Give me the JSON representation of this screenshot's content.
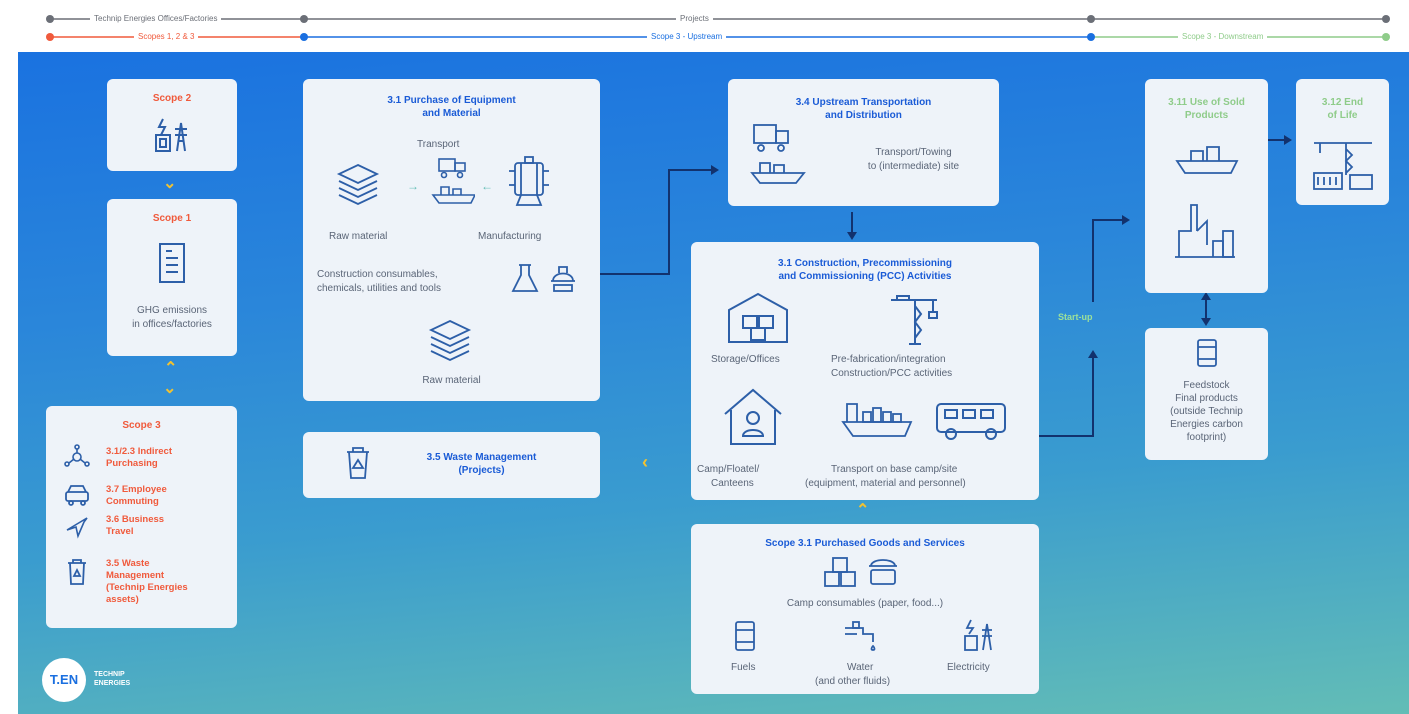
{
  "timeline": {
    "row1": {
      "label_a": "Technip Energies Offices/Factories",
      "label_b": "Projects",
      "color": "#6b6f77"
    },
    "row2": {
      "label_a": "Scopes 1, 2 & 3",
      "label_b": "Scope 3 - Upstream",
      "label_c": "Scope 3 - Downstream",
      "colors": {
        "a": "#f05a3c",
        "b": "#1a6fe0",
        "c": "#8fcc8a"
      }
    }
  },
  "scope2": {
    "title": "Scope 2"
  },
  "scope1": {
    "title": "Scope 1",
    "text1": "GHG emissions",
    "text2": "in offices/factories"
  },
  "scope3": {
    "title": "Scope 3",
    "item1": [
      "3.1/2.3 Indirect",
      "Purchasing"
    ],
    "item2": [
      "3.7 Employee",
      "Commuting"
    ],
    "item3": [
      "3.6 Business",
      "Travel"
    ],
    "item4": [
      "3.5 Waste",
      "Management",
      "(Technip Energies",
      "assets)"
    ]
  },
  "purchase": {
    "title1": "3.1 Purchase of Equipment",
    "title2": "and Material",
    "transport": "Transport",
    "raw1": "Raw material",
    "manufacturing": "Manufacturing",
    "consumables1": "Construction consumables,",
    "consumables2": "chemicals, utilities and tools",
    "raw2": "Raw material"
  },
  "waste": {
    "title1": "3.5 Waste Management",
    "title2": "(Projects)"
  },
  "transportation": {
    "title1": "3.4 Upstream Transportation",
    "title2": "and Distribution",
    "text1": "Transport/Towing",
    "text2": "to (intermediate) site"
  },
  "pcc": {
    "title1": "3.1 Construction, Precommissioning",
    "title2": "and Commissioning (PCC) Activities",
    "storage": "Storage/Offices",
    "prefab1": "Pre-fabrication/integration",
    "prefab2": "Construction/PCC activities",
    "camp1": "Camp/Floatel/",
    "camp2": "Canteens",
    "transport1": "Transport on base camp/site",
    "transport2": "(equipment, material and personnel)"
  },
  "goods": {
    "title": "Scope 3.1 Purchased Goods and Services",
    "camp": "Camp consumables (paper, food...)",
    "fuels": "Fuels",
    "water1": "Water",
    "water2": "(and other fluids)",
    "electricity": "Electricity"
  },
  "startup": "Start-up",
  "use": {
    "title1": "3.11 Use of Sold",
    "title2": "Products"
  },
  "eol": {
    "title1": "3.12 End",
    "title2": "of Life"
  },
  "feedstock": {
    "l1": "Feedstock",
    "l2": "Final products",
    "l3": "(outside Technip",
    "l4": "Energies carbon",
    "l5": "footprint)"
  },
  "logo": {
    "mark": "T.EN",
    "word1": "TECHNIP",
    "word2": "ENERGIES"
  },
  "colors": {
    "accent_blue": "#1a5bd6",
    "scope_red": "#f05a3c",
    "downstream_green": "#8fcc8a",
    "chevron_yellow": "#f2c230",
    "icon_blue": "#2d5fa8"
  }
}
